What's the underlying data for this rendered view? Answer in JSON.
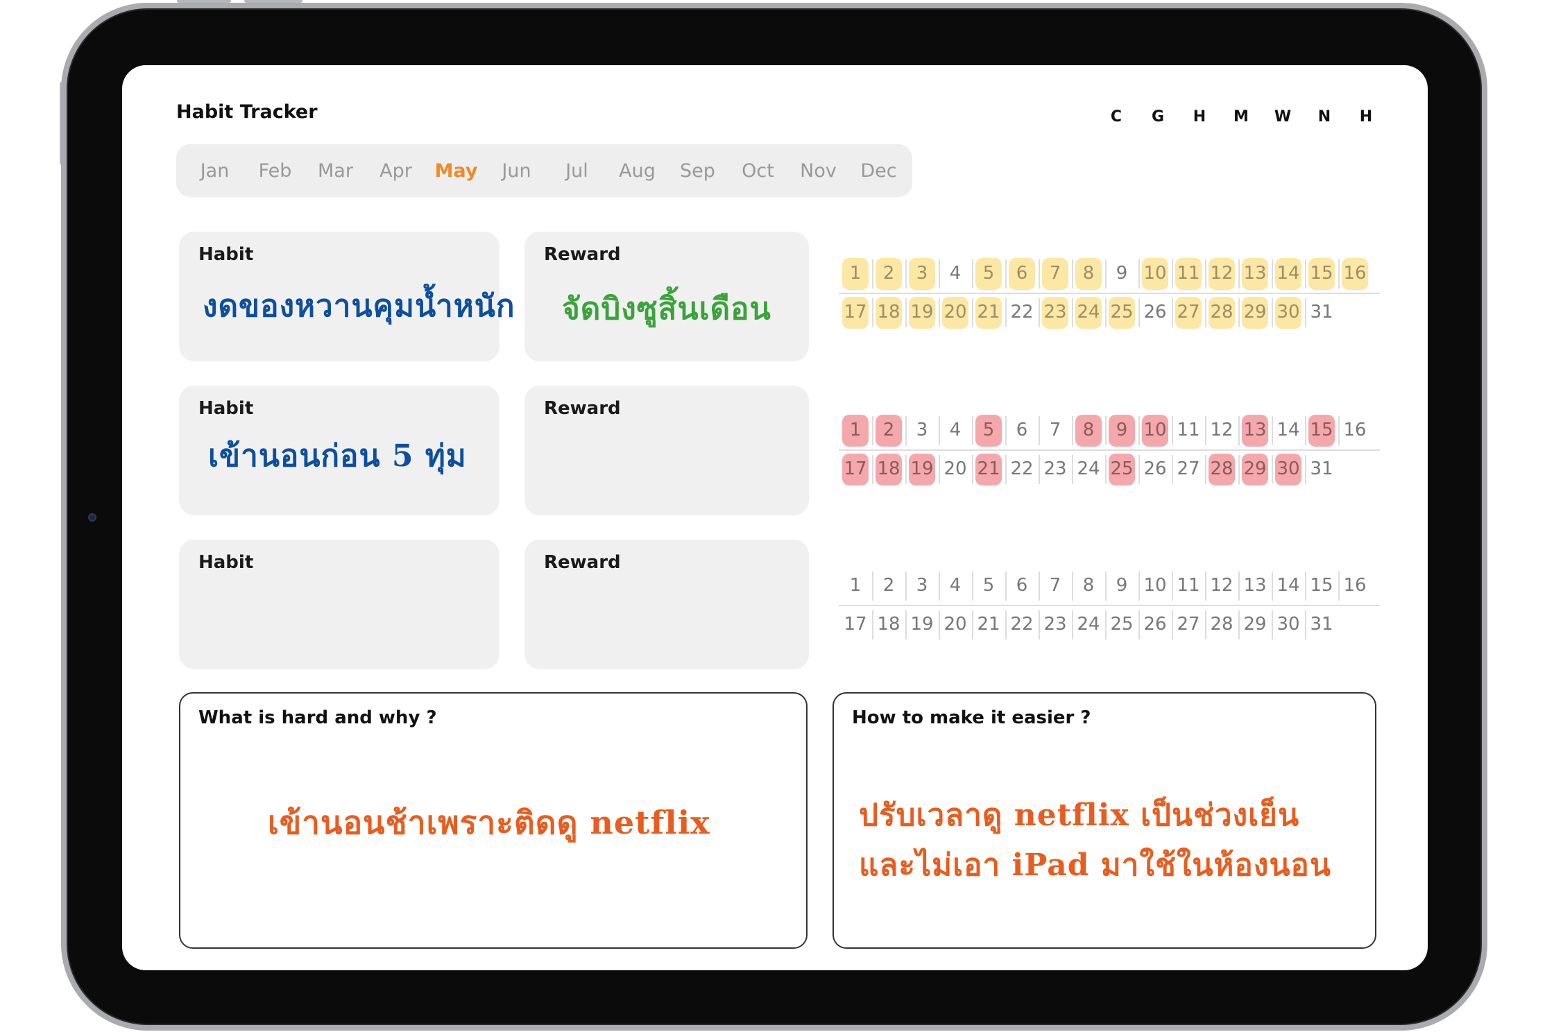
{
  "app": {
    "title": "Habit Tracker"
  },
  "letters": [
    "C",
    "G",
    "H",
    "M",
    "W",
    "N",
    "H"
  ],
  "months": {
    "items": [
      "Jan",
      "Feb",
      "Mar",
      "Apr",
      "May",
      "Jun",
      "Jul",
      "Aug",
      "Sep",
      "Oct",
      "Nov",
      "Dec"
    ],
    "active": "May"
  },
  "rows": [
    {
      "habit_label": "Habit",
      "habit_text": "งดของหวานคุมน้ำหนัก",
      "reward_label": "Reward",
      "reward_text": "จัดบิงซูสิ้นเดือน",
      "mark_color_name": "yellow",
      "mark_color": "#fde7a4",
      "marked_days": [
        1,
        2,
        3,
        5,
        6,
        7,
        8,
        10,
        11,
        12,
        13,
        14,
        15,
        16,
        17,
        18,
        19,
        20,
        21,
        23,
        24,
        25,
        27,
        28,
        29,
        30
      ]
    },
    {
      "habit_label": "Habit",
      "habit_text": "เข้านอนก่อน 5 ทุ่ม",
      "reward_label": "Reward",
      "reward_text": "",
      "mark_color_name": "red",
      "mark_color": "#f5a8ab",
      "marked_days": [
        1,
        2,
        5,
        8,
        9,
        10,
        13,
        15,
        17,
        18,
        19,
        21,
        25,
        28,
        29,
        30
      ]
    },
    {
      "habit_label": "Habit",
      "habit_text": "",
      "reward_label": "Reward",
      "reward_text": "",
      "mark_color_name": "none",
      "mark_color": "",
      "marked_days": []
    }
  ],
  "reflection": {
    "hard": {
      "label": "What is hard and why ?",
      "text": "เข้านอนช้าเพราะติดดู netflix"
    },
    "easier": {
      "label": "How to make it easier ?",
      "line1": "ปรับเวลาดู netflix เป็นช่วงเย็น",
      "line2": "และไม่เอา iPad มาใช้ในห้องนอน"
    }
  },
  "colors": {
    "habit_ink": "#0d4f9e",
    "reward_ink": "#3aa33a",
    "note_ink": "#e85d1f",
    "active_month": "#ef8a2a"
  }
}
